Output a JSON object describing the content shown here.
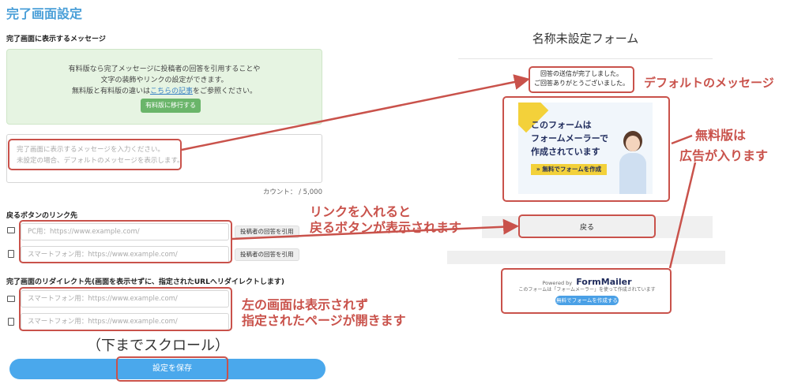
{
  "page_title": "完了画面設定",
  "message_section": {
    "label": "完了画面に表示するメッセージ",
    "info_line1": "有料版なら完了メッセージに投稿者の回答を引用することや",
    "info_line2": "文字の装飾やリンクの設定ができます。",
    "info_line3_pre": "無料版と有料版の違いは",
    "info_link": "こちらの記事",
    "info_line3_post": "をご参照ください。",
    "upgrade_button": "有料版に移行する",
    "textarea_placeholder_1": "完了画面に表示するメッセージを入力ください。",
    "textarea_placeholder_2": "未設定の場合、デフォルトのメッセージを表示します。",
    "counter": "カウント： / 5,000"
  },
  "back_button_section": {
    "label": "戻るボタンのリンク先",
    "pc_placeholder": "PC用：https://www.example.com/",
    "sp_placeholder": "スマートフォン用：https://www.example.com/",
    "quote_button": "投稿者の回答を引用"
  },
  "redirect_section": {
    "label": "完了画面のリダイレクト先(画面を表示せずに、指定されたURLへリダイレクトします)",
    "sp_placeholder_1": "スマートフォン用：https://www.example.com/",
    "sp_placeholder_2": "スマートフォン用：https://www.example.com/"
  },
  "scroll_note": "（下までスクロール）",
  "save_button": "設定を保存",
  "preview": {
    "form_title": "名称未設定フォーム",
    "default_message_1": "回答の送信が完了しました。",
    "default_message_2": "ご回答ありがとうございました。",
    "ad_line1": "このフォームは",
    "ad_line2": "フォームメーラーで",
    "ad_line3": "作成されています",
    "ad_cta": "» 無料でフォームを作成",
    "back_button": "戻る",
    "powered_by": "Powered by",
    "logo_text": "FormMailer",
    "footer_note": "このフォームは「フォームメーラー」を使って作成されています",
    "footer_button": "無料でフォームを作成する"
  },
  "annotations": {
    "default_message": "デフォルトのメッセージ",
    "free_version_1": "無料版は",
    "free_version_2": "広告が入ります",
    "link_1": "リンクを入れると",
    "link_2": "戻るボタンが表示されます",
    "redirect_1": "左の画面は表示されず",
    "redirect_2": "指定されたページが開きます"
  },
  "colors": {
    "accent": "#4aa8ec",
    "annotation_red": "#c9524b",
    "info_bg": "#e6f4e2",
    "upgrade_green": "#6ab56a"
  }
}
